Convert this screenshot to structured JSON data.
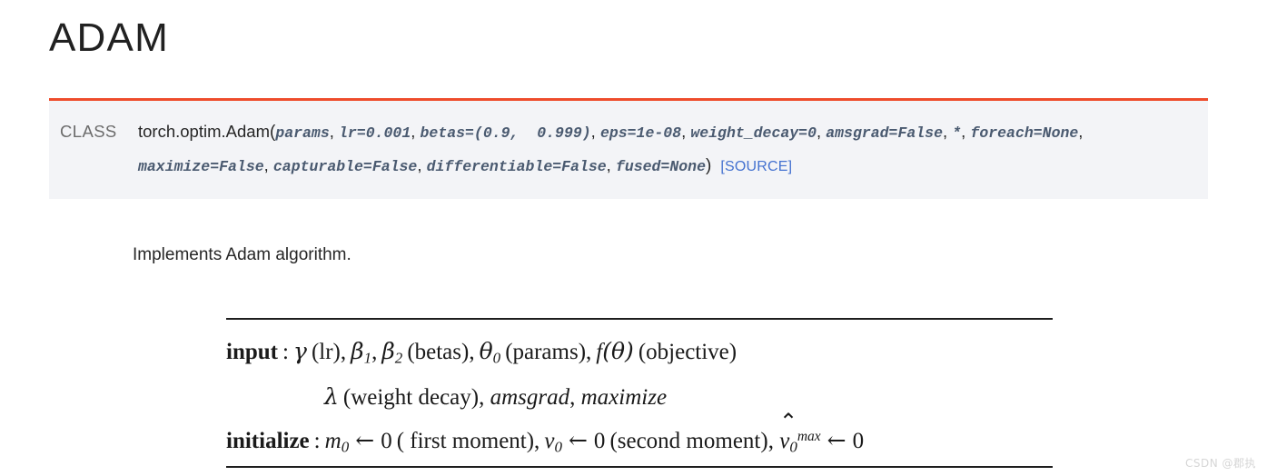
{
  "page": {
    "title": "ADAM",
    "background_color": "#ffffff"
  },
  "signature": {
    "accent_color": "#ee4c2c",
    "background_color": "#f3f4f7",
    "class_label": "CLASS",
    "qualified_name": "torch.optim.Adam",
    "open_paren": "(",
    "close_paren": ")",
    "source_link_label": "[SOURCE]",
    "source_link_color": "#4472d0",
    "params": [
      {
        "text": "params",
        "trailing": ","
      },
      {
        "text": "lr=0.001",
        "trailing": ","
      },
      {
        "text": "betas=(0.9,  0.999)",
        "trailing": ","
      },
      {
        "text": "eps=1e-08",
        "trailing": ","
      },
      {
        "text": "weight_decay=0",
        "trailing": ","
      },
      {
        "text": "amsgrad=False",
        "trailing": ","
      },
      {
        "text": "*",
        "trailing": ","
      },
      {
        "text": "foreach=None",
        "trailing": ","
      },
      {
        "text": "maximize=False",
        "trailing": ","
      },
      {
        "text": "capturable=False",
        "trailing": ","
      },
      {
        "text": "differentiable=False",
        "trailing": ","
      },
      {
        "text": "fused=None",
        "trailing": ""
      }
    ]
  },
  "description": {
    "text": "Implements Adam algorithm."
  },
  "algorithm": {
    "rule_color": "#1e1e1e",
    "input": {
      "keyword": "input",
      "colon": ":",
      "gamma": "γ",
      "lr_note": "(lr),",
      "beta": "β",
      "beta1_sub": "1",
      "beta2_sub": "2",
      "betas_note": "(betas),",
      "theta": "θ",
      "theta_sub": "0",
      "params_note": "(params),",
      "f_symbol": "f",
      "f_arg": "(θ)",
      "objective_note": "(objective)"
    },
    "input_second": {
      "lambda": "λ",
      "weight_decay_note": "(weight decay),",
      "amsgrad": "amsgrad",
      "amsgrad_comma": ",",
      "maximize": "maximize"
    },
    "initialize": {
      "keyword": "initialize",
      "colon": ":",
      "m": "m",
      "m_sub": "0",
      "arrow": "←",
      "zero": "0",
      "first_moment_note": "( first moment),",
      "v": "v",
      "v_sub": "0",
      "arrow2": "←",
      "zero2": "0",
      "second_moment_note": "(second moment),",
      "vhat": "v",
      "vhat_sub": "0",
      "vhat_hat": "⌃",
      "vhat_sup": "max",
      "arrow3": "←",
      "zero3": "0"
    }
  },
  "watermark": {
    "text": "CSDN @郡执"
  }
}
